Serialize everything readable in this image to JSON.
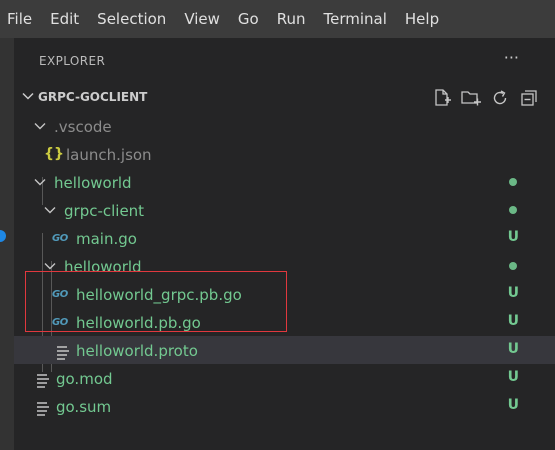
{
  "menubar": {
    "items": [
      "File",
      "Edit",
      "Selection",
      "View",
      "Go",
      "Run",
      "Terminal",
      "Help"
    ]
  },
  "explorer": {
    "title": "EXPLORER",
    "more": "···"
  },
  "section": {
    "title": "GRPC-GOCLIENT"
  },
  "tree": [
    {
      "label": ".vscode",
      "status": ""
    },
    {
      "label": "launch.json",
      "status": ""
    },
    {
      "label": "helloworld",
      "status": "dot"
    },
    {
      "label": "grpc-client",
      "status": "dot"
    },
    {
      "label": "main.go",
      "status": "U"
    },
    {
      "label": "helloworld",
      "status": "dot"
    },
    {
      "label": "helloworld_grpc.pb.go",
      "status": "U"
    },
    {
      "label": "helloworld.pb.go",
      "status": "U"
    },
    {
      "label": "helloworld.proto",
      "status": "U"
    },
    {
      "label": "go.mod",
      "status": "U"
    },
    {
      "label": "go.sum",
      "status": "U"
    }
  ],
  "colors": {
    "untracked": "#73c991",
    "highlight_box": "#e0383e",
    "go_icon": "#519aba",
    "json_icon": "#cbcb41"
  },
  "icons": {
    "go": "GO",
    "json": "{}"
  }
}
